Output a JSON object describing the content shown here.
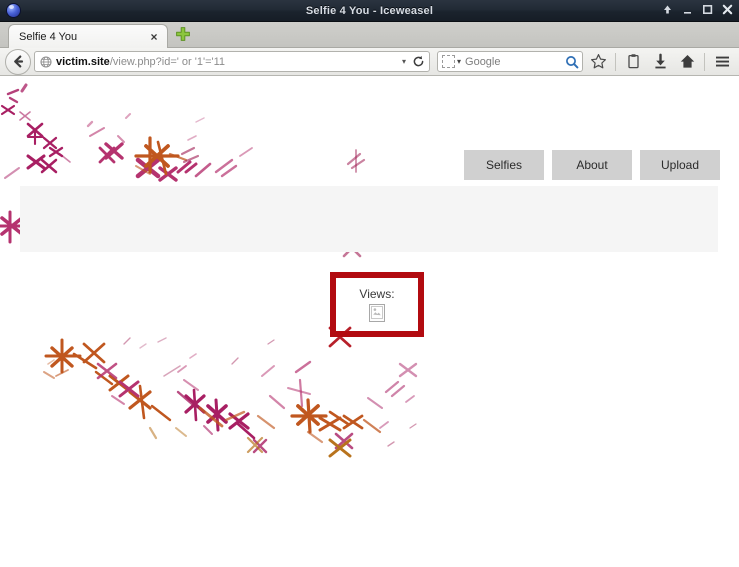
{
  "window": {
    "title": "Selfie 4 You - Iceweasel",
    "app_icon": "iceweasel-globe-icon",
    "controls": {
      "shade_label": "Shade",
      "minimize_label": "Minimize",
      "maximize_label": "Maximize",
      "close_label": "Close"
    }
  },
  "tabbar": {
    "tabs": [
      {
        "label": "Selfie 4 You",
        "close_label": "×",
        "active": true
      }
    ],
    "new_tab_label": "+"
  },
  "toolbar": {
    "back_label": "Back",
    "url": {
      "domain": "victim.site",
      "path": "/view.php?id=' or '1'='11",
      "full": "victim.site/view.php?id=' or '1'='11",
      "dropdown_label": "▾",
      "reload_label": "↻",
      "site_identity_icon": "globe-icon"
    },
    "search": {
      "engine": "Google",
      "placeholder": "Google",
      "engine_caret": "▾",
      "go_icon": "magnifier-icon"
    },
    "icons": [
      {
        "name": "bookmark-star-icon",
        "label": "Bookmark this page"
      },
      {
        "name": "reading-list-icon",
        "label": "Show your bookmarks"
      },
      {
        "name": "downloads-icon",
        "label": "Downloads"
      },
      {
        "name": "home-icon",
        "label": "Home"
      },
      {
        "name": "menu-hamburger-icon",
        "label": "Open menu"
      }
    ]
  },
  "page": {
    "background_color": "#ffffff",
    "banner_color": "#f5f5f5",
    "nav_buttons": [
      {
        "label": "Selfies"
      },
      {
        "label": "About"
      },
      {
        "label": "Upload"
      }
    ],
    "views": {
      "label": "Views:",
      "image_state": "broken-image-placeholder",
      "highlight_color": "#b20b10"
    },
    "doodle_colors": [
      "#a81f63",
      "#b5336f",
      "#c0571f",
      "#b8731d",
      "#9e1b52",
      "#d08a3a"
    ]
  }
}
